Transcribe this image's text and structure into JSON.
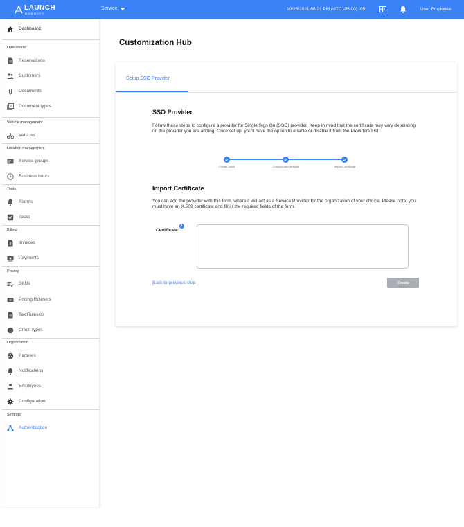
{
  "header": {
    "logo_text": "LAUNCH",
    "logo_subtext": "MOBILITY",
    "service_label": "Service",
    "datetime": "10/25/2021 05:21 PM (UTC -05:00) -05",
    "user_label": "User Employee"
  },
  "sidebar": {
    "dashboard": "Dashboard",
    "sections": {
      "operations": "Operations",
      "vehicle_management": "Vehicle management",
      "location_management": "Location management",
      "tools": "Tools",
      "billing": "Billing",
      "pricing": "Pricing",
      "organization": "Organization",
      "settings": "Settings"
    },
    "items": {
      "reservations": "Reservations",
      "customers": "Customers",
      "documents": "Documents",
      "document_types": "Document types",
      "vehicles": "Vehicles",
      "service_groups": "Service groups",
      "business_hours": "Business hours",
      "alarms": "Alarms",
      "tasks": "Tasks",
      "invoices": "Invoices",
      "payments": "Payments",
      "skus": "SKUs",
      "pricing_rulesets": "Pricing Rulesets",
      "tax_rulesets": "Tax Rulesets",
      "credit_types": "Credit types",
      "partners": "Partners",
      "notifications": "Notifications",
      "employees": "Employees",
      "configuration": "Configuration",
      "authentication": "Authentication"
    }
  },
  "main": {
    "page_title": "Customization Hub",
    "tab_label": "Setup SSO Provider",
    "sso_heading": "SSO Provider",
    "sso_text": "Follow these steps to configure a provider for Single Sign On (SSO) provider. Keep in mind that the certificate may vary depending on the provider you are adding. Once set up, you'll have the option to enable or disable it from the Providers List",
    "steps": [
      "Create SAML",
      "Connect with provider",
      "Import Certificate"
    ],
    "import_heading": "Import Certificate",
    "import_text": "You can add the provider with this form, where it will act as a Service Provider for the organization of your choice. Please note, you must have an X.509 certificate and fill in the required fields of the form.",
    "certificate_label": "Certificate",
    "required_mark": "*",
    "info_glyph": "i",
    "certificate_value": "",
    "back_link": "Back to previous step",
    "create_button": "Create"
  },
  "colors": {
    "accent": "#3b82f6",
    "disabled_button": "#a9acb2"
  },
  "icons": {
    "header": [
      "launch-logo-icon",
      "caret-down-icon",
      "book-icon",
      "bell-icon"
    ],
    "sidebar": [
      "home-icon",
      "document-icon",
      "people-icon",
      "paperclip-icon",
      "stack-icon",
      "bike-icon",
      "group-icon",
      "clock-icon",
      "bell-icon",
      "checkbox-icon",
      "invoice-icon",
      "payment-icon",
      "sku-icon",
      "ruleset-icon",
      "tax-icon",
      "circle-icon",
      "partners-icon",
      "person-icon",
      "gear-icon",
      "network-icon"
    ]
  }
}
